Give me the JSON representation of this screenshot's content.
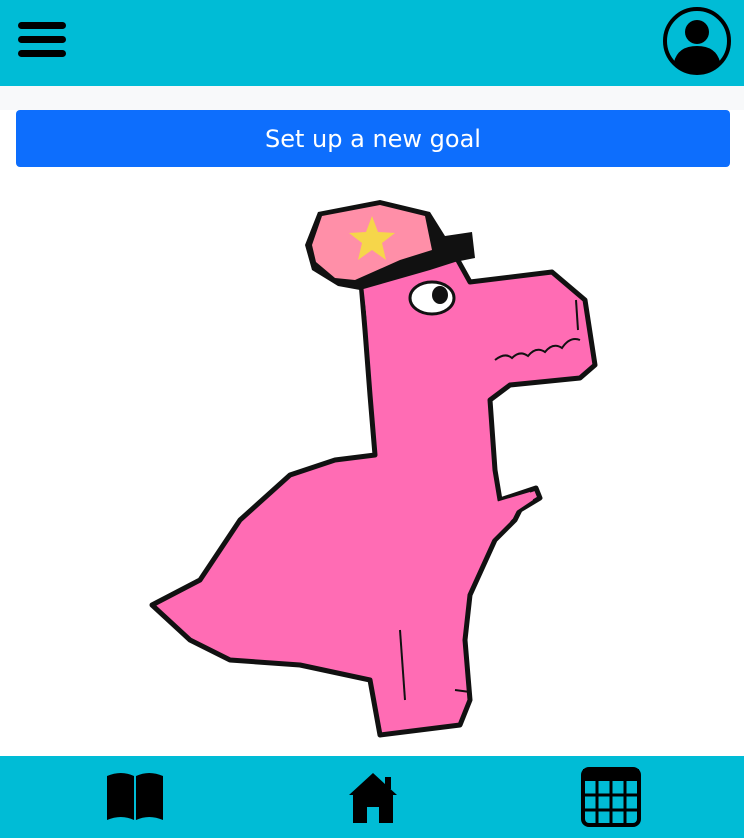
{
  "topbar": {
    "menu_icon": "hamburger-menu-icon",
    "profile_icon": "user-profile-icon"
  },
  "main": {
    "goal_button_label": "Set up a new goal",
    "mascot_image": "pink-dinosaur-with-cap"
  },
  "bottom_nav": {
    "items": [
      {
        "icon": "book-icon"
      },
      {
        "icon": "home-icon"
      },
      {
        "icon": "calendar-grid-icon"
      }
    ]
  },
  "colors": {
    "bar_bg": "#00bcd6",
    "primary_button": "#0d6efd",
    "dino_pink": "#ff6cb4",
    "cap_pink": "#ff8fa8",
    "star_yellow": "#f6d64a"
  }
}
